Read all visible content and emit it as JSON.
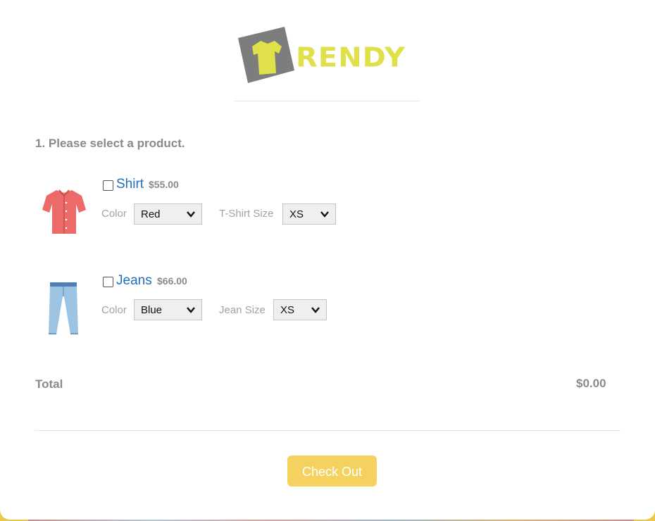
{
  "logo": {
    "text": "RENDY",
    "brand": "T-RENDY"
  },
  "section_title": "1. Please select a product.",
  "products": [
    {
      "name": "Shirt",
      "price": "$55.00",
      "checked": false,
      "image": "shirt-icon",
      "color_label": "Color",
      "color_value": "Red",
      "size_label": "T-Shirt Size",
      "size_value": "XS"
    },
    {
      "name": "Jeans",
      "price": "$66.00",
      "checked": false,
      "image": "jeans-icon",
      "color_label": "Color",
      "color_value": "Blue",
      "size_label": "Jean Size",
      "size_value": "XS"
    }
  ],
  "total": {
    "label": "Total",
    "value": "$0.00"
  },
  "checkout_label": "Check Out",
  "colors": {
    "accent": "#f5d25f",
    "link": "#1e6fc0",
    "logo_yellow": "#dfe04a",
    "logo_gray": "#7d7d7d",
    "muted_text": "#8a8a8a"
  }
}
